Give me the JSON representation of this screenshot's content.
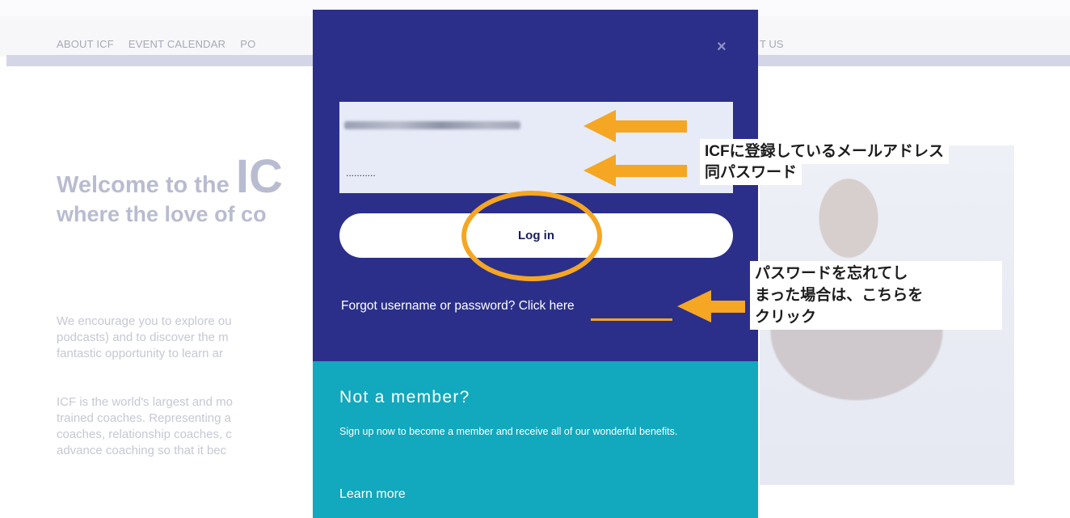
{
  "background": {
    "nav": [
      "ABOUT ICF",
      "EVENT CALENDAR",
      "PO"
    ],
    "nav_tail": "T US",
    "hero": {
      "line1": "Welcome to the ",
      "line1_big": "IC",
      "line2": "where the love of co"
    },
    "para1": [
      "We encourage you to explore ou",
      "podcasts) and to discover the m",
      "fantastic opportunity to learn ar"
    ],
    "para2": [
      "ICF is the world's largest and mo",
      "trained coaches. Representing a",
      "coaches, relationship coaches, c",
      "advance coaching so that it bec"
    ]
  },
  "modal": {
    "close": "×",
    "password_value": "...........",
    "login_label": "Log in",
    "forgot_text": "Forgot username or password? ",
    "forgot_link": "Click here",
    "not_member_title": "Not a member?",
    "not_member_desc": "Sign up now to become a member and receive all of our wonderful benefits.",
    "learn_more": "Learn more"
  },
  "annotations": {
    "email": "ICFに登録しているメールアドレス",
    "password": "同パスワード",
    "forgot": [
      "パスワードを忘れてし",
      "まった場合は、こちらを",
      "クリック"
    ]
  },
  "colors": {
    "modal_bg": "#2b2f8a",
    "teal": "#12a8bd",
    "highlight_orange": "#f5a623"
  }
}
